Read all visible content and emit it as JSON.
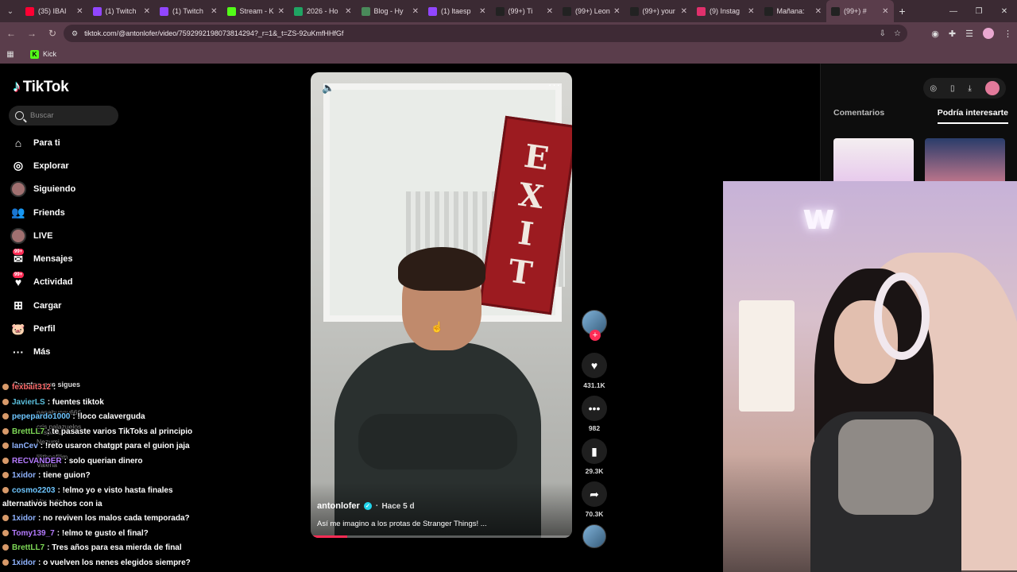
{
  "browser": {
    "tabs": [
      {
        "label": "(35) IBAI",
        "color": "#ff0033",
        "active": false
      },
      {
        "label": "(1) Twitch",
        "color": "#9146ff",
        "active": false
      },
      {
        "label": "(1) Twitch",
        "color": "#9146ff",
        "active": false
      },
      {
        "label": "Stream - K",
        "color": "#53fc18",
        "active": false
      },
      {
        "label": "2026 - Ho",
        "color": "#1fa463",
        "active": false
      },
      {
        "label": "Blog - Hy",
        "color": "#4a8a5a",
        "active": false
      },
      {
        "label": "(1) ltaesp",
        "color": "#9146ff",
        "active": false
      },
      {
        "label": "(99+) Ti",
        "color": "#222222",
        "active": false
      },
      {
        "label": "(99+) Leon",
        "color": "#222222",
        "active": false
      },
      {
        "label": "(99+) your",
        "color": "#222222",
        "active": false
      },
      {
        "label": "(9) Instag",
        "color": "#e1306c",
        "active": false
      },
      {
        "label": "Mañana:",
        "color": "#222222",
        "active": false
      },
      {
        "label": "(99+) #",
        "color": "#222222",
        "active": true
      }
    ],
    "url": "tiktok.com/@antonlofer/video/7592992198073814294?_r=1&_t=ZS-92uKmfHHfGf",
    "bookmark": "Kick"
  },
  "tiktok": {
    "brand": "TikTok",
    "search_placeholder": "Buscar",
    "nav": [
      {
        "label": "Para ti",
        "icon": "home-icon"
      },
      {
        "label": "Explorar",
        "icon": "compass-icon"
      },
      {
        "label": "Siguiendo",
        "icon": "following-icon"
      },
      {
        "label": "Friends",
        "icon": "friends-icon"
      },
      {
        "label": "LIVE",
        "icon": "live-icon"
      },
      {
        "label": "Mensajes",
        "icon": "messages-icon",
        "badge": "99+"
      },
      {
        "label": "Actividad",
        "icon": "activity-icon",
        "badge": "99+"
      },
      {
        "label": "Cargar",
        "icon": "upload-icon"
      },
      {
        "label": "Perfil",
        "icon": "profile-icon"
      },
      {
        "label": "Más",
        "icon": "more-icon"
      }
    ],
    "following_title": "Cuentas que sigues",
    "following_accounts": [
      "nanabunny666",
      "cris palazuelos",
      "crispalazuelos",
      "Nezumi",
      "lilithnefilim",
      "Valeria",
      "Ver todo"
    ],
    "video": {
      "author": "antonlofer",
      "time": "Hace 5 d",
      "description": "Así me imagino a los protas de Stranger Things! ...",
      "progress": 0.14,
      "sign_letters": [
        "E",
        "X",
        "I",
        "T"
      ]
    },
    "actions": {
      "likes": "431.1K",
      "comments": "982",
      "saves": "29.3K",
      "shares": "70.3K"
    },
    "right_tabs": [
      "Comentarios",
      "Podría interesarte"
    ]
  },
  "chat": [
    {
      "user": "fexbait312",
      "color": "#ff6b6b",
      "text": ":"
    },
    {
      "user": "JavierLS",
      "color": "#5bc0de",
      "text": ": fuentes tiktok"
    },
    {
      "user": "pepepardo1000",
      "color": "#6ec6ff",
      "text": ": !loco calaverguda"
    },
    {
      "user": "BrettLL7",
      "color": "#7ed957",
      "text": ": te pasaste varios TikToks al principio"
    },
    {
      "user": "IanCev",
      "color": "#8fb3ff",
      "text": ": !reto usaron chatgpt para el guion jaja"
    },
    {
      "user": "RECVANDER",
      "color": "#b57bff",
      "text": ": solo querian dinero"
    },
    {
      "user": "1xidor",
      "color": "#8fb3ff",
      "text": ": tiene guion?"
    },
    {
      "user": "cosmo2203",
      "color": "#6ec6ff",
      "text": ": !elmo yo e visto hasta finales"
    },
    {
      "user": "",
      "color": "#ffffff",
      "text": "alternativos hechos con ia"
    },
    {
      "user": "1xidor",
      "color": "#8fb3ff",
      "text": ": no reviven los malos cada temporada?"
    },
    {
      "user": "Tomy139_7",
      "color": "#b57bff",
      "text": ": !elmo te gusto el final?"
    },
    {
      "user": "BrettLL7",
      "color": "#7ed957",
      "text": ": Tres años para esa mierda de final"
    },
    {
      "user": "1xidor",
      "color": "#8fb3ff",
      "text": ": o vuelven los nenes elegidos siempre?"
    }
  ],
  "webcam": {
    "neon_text": "w"
  }
}
